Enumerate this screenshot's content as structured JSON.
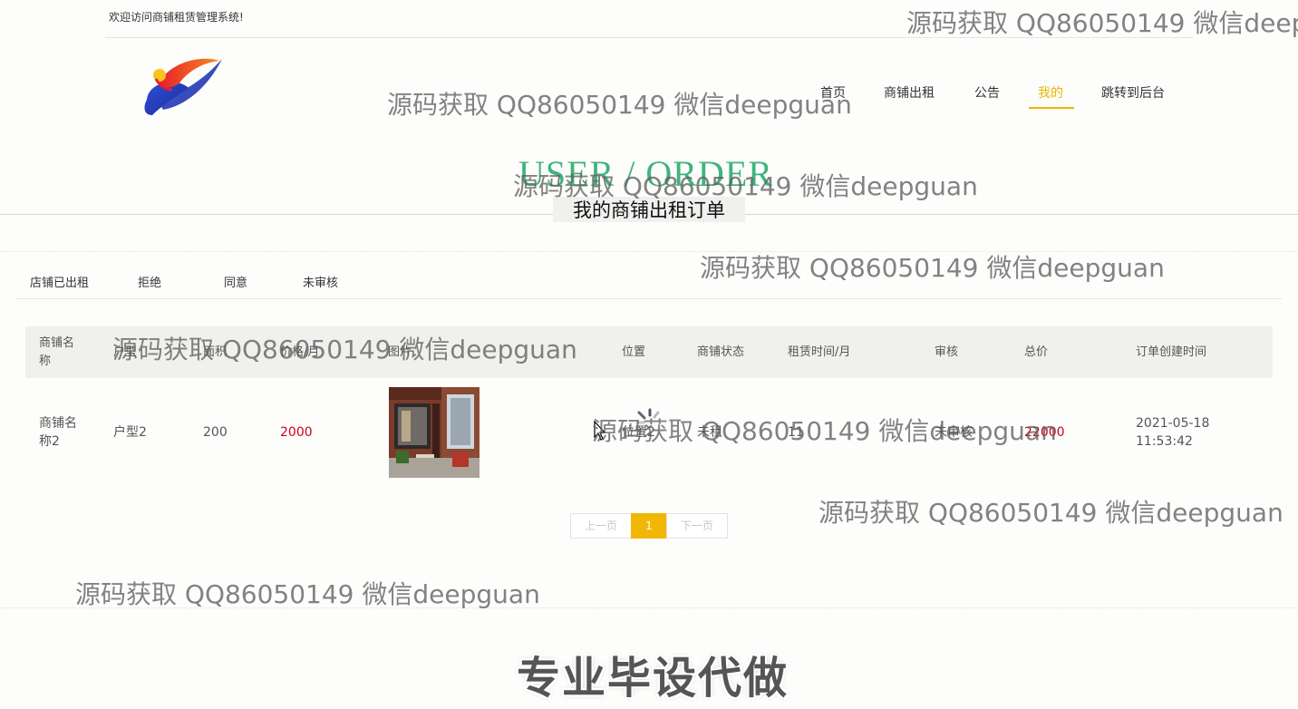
{
  "header": {
    "welcome": "欢迎访问商铺租赁管理系统!",
    "nav": [
      {
        "label": "首页"
      },
      {
        "label": "商铺出租"
      },
      {
        "label": "公告"
      },
      {
        "label": "我的",
        "active": true
      },
      {
        "label": "跳转到后台"
      }
    ]
  },
  "page": {
    "title_en": "USER / ORDER",
    "title_zh": "我的商铺出租订单"
  },
  "filters": [
    "店铺已出租",
    "拒绝",
    "同意",
    "未审核"
  ],
  "table": {
    "columns": [
      "商铺名称",
      "户型",
      "面积",
      "价格/月",
      "图片",
      "位置",
      "商铺状态",
      "租赁时间/月",
      "审核",
      "总价",
      "订单创建时间"
    ],
    "rows": [
      {
        "name": "商铺名称2",
        "layout": "户型2",
        "area": "200",
        "price": "2000",
        "image": "storefront-photo",
        "location": "位置2",
        "status": "未租",
        "lease_months": "11",
        "review": "未审核",
        "total": "22000",
        "created": "2021-05-18 11:53:42"
      }
    ]
  },
  "pagination": {
    "prev": "上一页",
    "current": "1",
    "next": "下一页"
  },
  "overlay": {
    "watermark": "源码获取 QQ86050149 微信deepguan",
    "banner": "专业毕设代做"
  },
  "colors": {
    "accent": "#e6b800",
    "price_red": "#d0021b",
    "hero_green": "#41b37c",
    "pager_active": "#f2b705"
  }
}
